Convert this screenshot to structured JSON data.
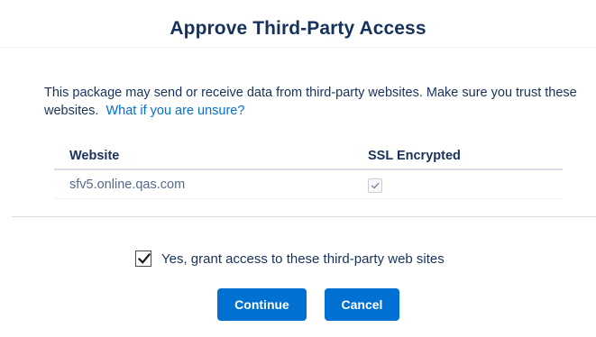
{
  "dialog": {
    "title": "Approve Third-Party Access",
    "message": "This package may send or receive data from third-party websites. Make sure you trust these websites.",
    "help_link": "What if you are unsure?"
  },
  "table": {
    "headers": {
      "website": "Website",
      "ssl": "SSL Encrypted"
    },
    "rows": [
      {
        "website": "sfv5.online.qas.com",
        "ssl_encrypted": true
      }
    ]
  },
  "grant": {
    "label": "Yes, grant access to these third-party web sites",
    "checked": true
  },
  "buttons": {
    "continue": "Continue",
    "cancel": "Cancel"
  },
  "colors": {
    "brand_blue": "#0070d2",
    "text_navy": "#16325c",
    "muted_text": "#54698d"
  }
}
